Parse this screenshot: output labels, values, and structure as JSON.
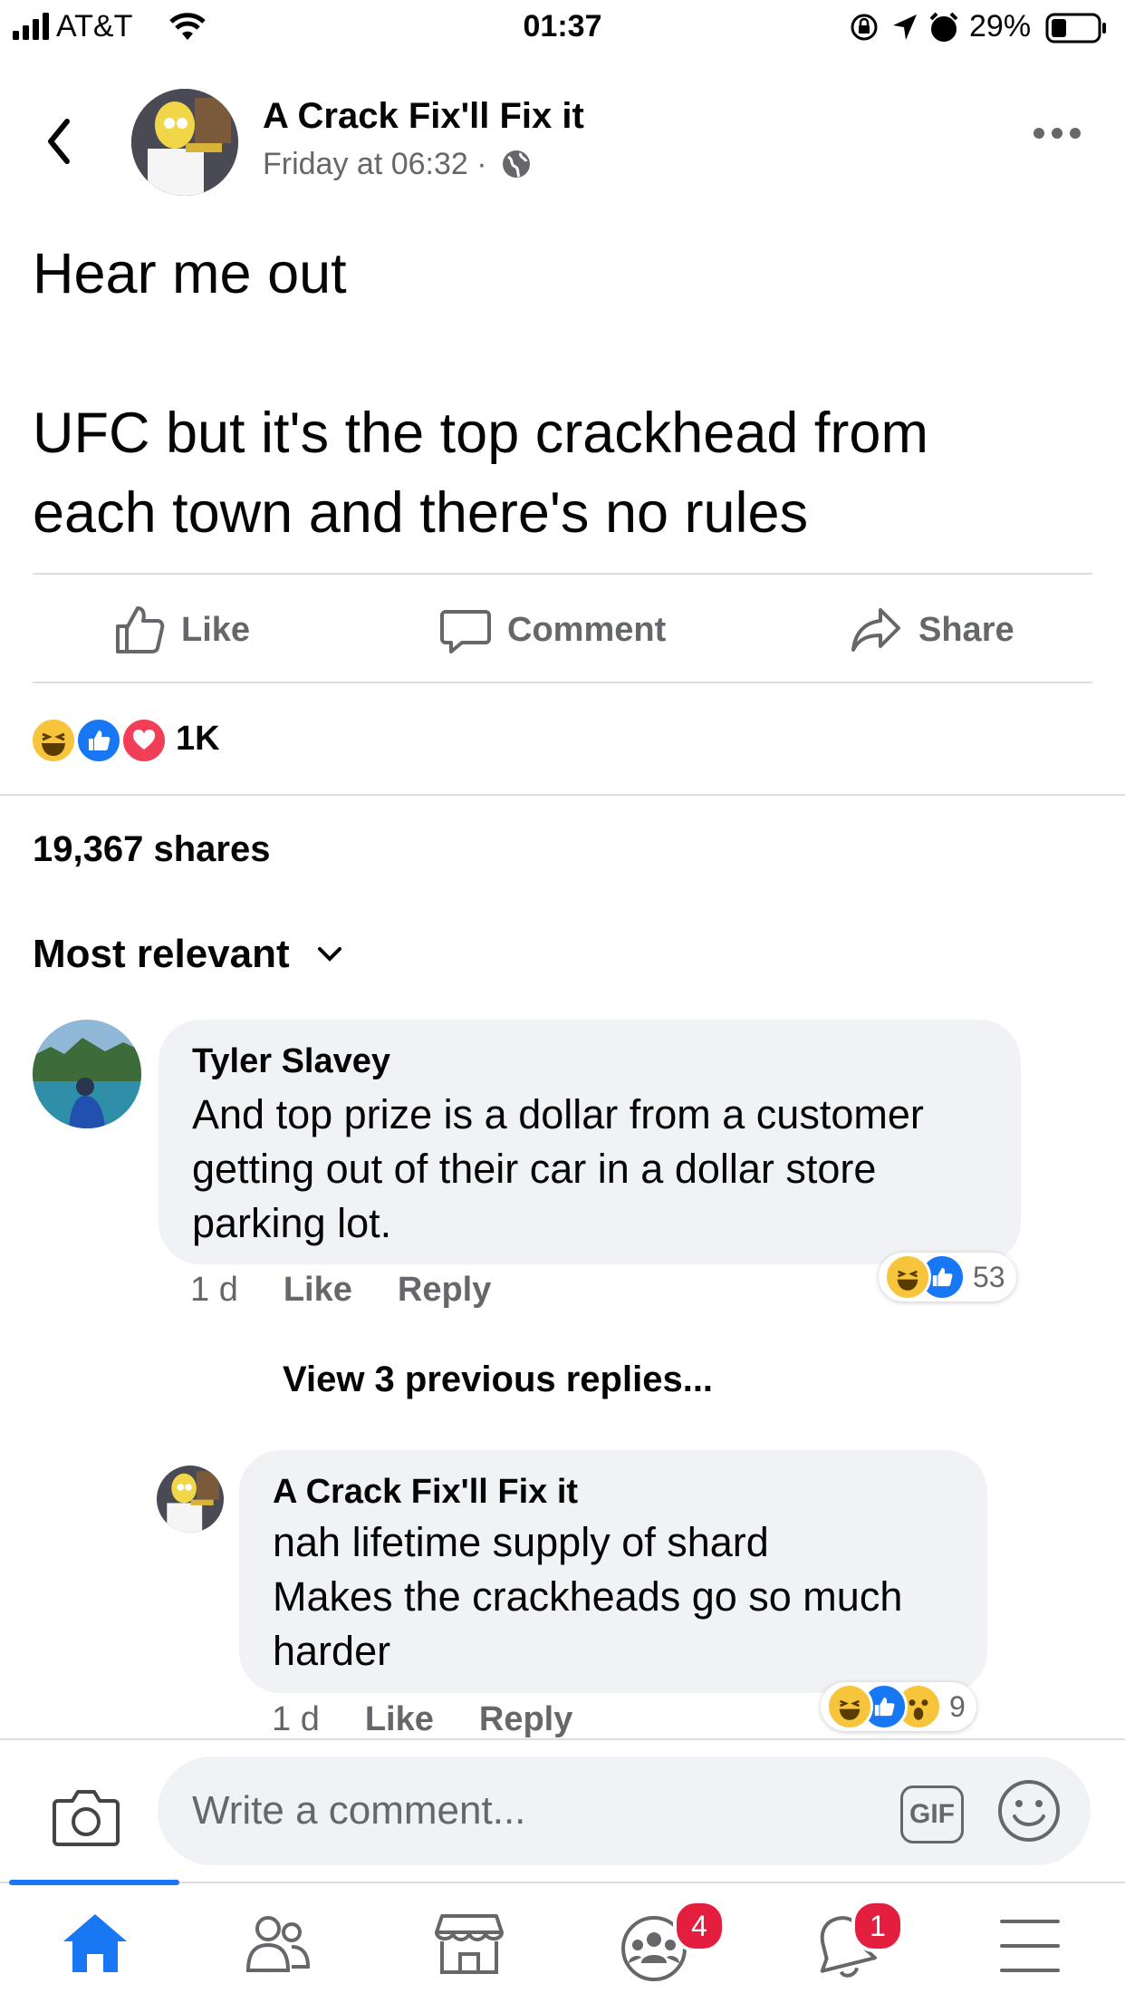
{
  "status_bar": {
    "carrier": "AT&T",
    "time": "01:37",
    "battery": "29%"
  },
  "post": {
    "author": "A Crack Fix'll Fix it",
    "timestamp": "Friday at 06:32 ·",
    "text_line1": "Hear me out",
    "text_line2": "UFC but it's the top crackhead from",
    "text_line3": "each town and there's no rules",
    "actions": {
      "like": "Like",
      "comment": "Comment",
      "share": "Share"
    },
    "reactions_count": "1K",
    "shares": "19,367 shares"
  },
  "sort_label": "Most relevant",
  "comments": [
    {
      "author": "Tyler Slavey",
      "lines": [
        "And top prize is a dollar from a customer",
        "getting out of their car in a dollar store",
        "parking lot."
      ],
      "age": "1 d",
      "like": "Like",
      "reply": "Reply",
      "reaction_count": "53"
    },
    {
      "author": "A Crack Fix'll Fix it",
      "lines": [
        "nah lifetime supply of shard",
        "Makes the crackheads go so much",
        "harder"
      ],
      "age": "1 d",
      "like": "Like",
      "reply": "Reply",
      "reaction_count": "9"
    }
  ],
  "view_replies": "View 3 previous replies...",
  "composer": {
    "placeholder": "Write a comment...",
    "gif": "GIF"
  },
  "tabbar": {
    "groups_badge": "4",
    "notifications_badge": "1"
  },
  "colors": {
    "accent": "#1877f2",
    "badge": "#e41e3f",
    "muted_text": "#65676b",
    "bubble": "#f0f2f5"
  }
}
